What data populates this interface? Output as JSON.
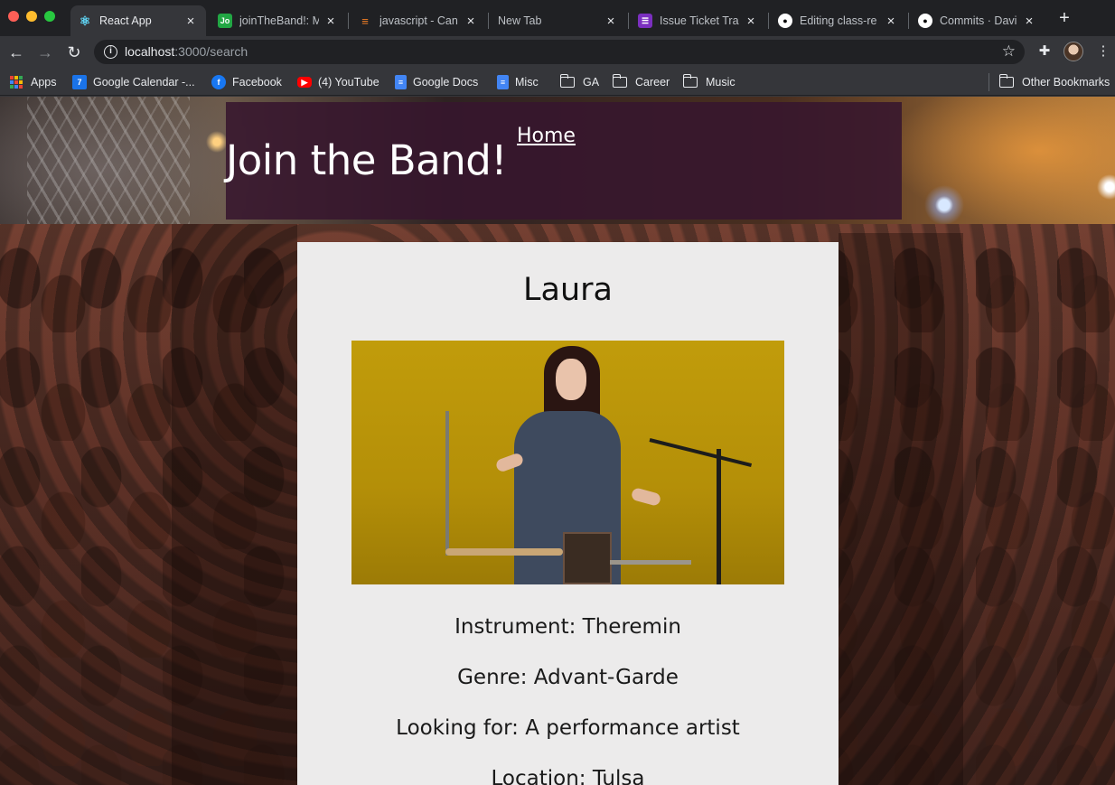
{
  "browser": {
    "tabs": [
      {
        "title": "React App",
        "active": true,
        "icon": "react-icon"
      },
      {
        "title": "joinTheBand!: M",
        "active": false,
        "icon": "jo-icon"
      },
      {
        "title": "javascript - Can",
        "active": false,
        "icon": "stackoverflow-icon"
      },
      {
        "title": "New Tab",
        "active": false,
        "icon": ""
      },
      {
        "title": "Issue Ticket Tra",
        "active": false,
        "icon": "list-icon"
      },
      {
        "title": "Editing class-re",
        "active": false,
        "icon": "github-icon"
      },
      {
        "title": "Commits · Davi",
        "active": false,
        "icon": "github-icon"
      }
    ],
    "url_host": "localhost",
    "url_path": ":3000/search",
    "bookmarks": [
      {
        "label": "Apps",
        "icon": "apps-grid-icon"
      },
      {
        "label": "Google Calendar -...",
        "icon": "calendar-icon"
      },
      {
        "label": "Facebook",
        "icon": "facebook-icon"
      },
      {
        "label": "(4) YouTube",
        "icon": "youtube-icon"
      },
      {
        "label": "Google Docs",
        "icon": "docs-icon"
      },
      {
        "label": "Misc",
        "icon": "docs-icon"
      },
      {
        "label": "GA",
        "icon": "folder-icon"
      },
      {
        "label": "Career",
        "icon": "folder-icon"
      },
      {
        "label": "Music",
        "icon": "folder-icon"
      }
    ],
    "other_bookmarks": "Other Bookmarks"
  },
  "header": {
    "title": "Join the Band!",
    "home_link": "Home"
  },
  "profile": {
    "name": "Laura",
    "instrument": "Instrument: Theremin",
    "genre": "Genre: Advant-Garde",
    "looking_for": "Looking for: A performance artist",
    "location": "Location: Tulsa"
  },
  "colors": {
    "header_box": "#37162d",
    "card_bg": "#ecebeb",
    "chrome_dark": "#202124",
    "chrome_toolbar": "#35363a"
  }
}
